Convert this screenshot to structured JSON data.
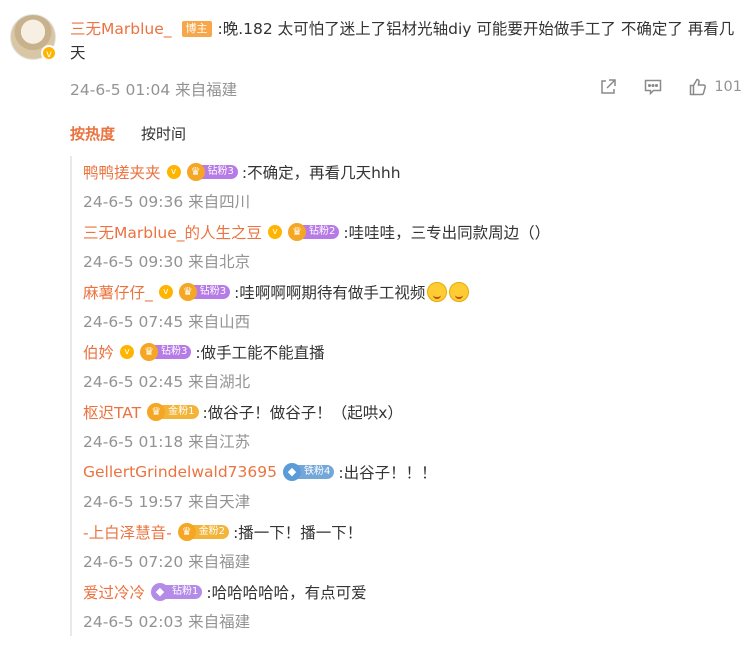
{
  "post": {
    "author": "三无Marblue_",
    "author_badge": "博主",
    "text": ":晚.182 太可怕了迷上了铝材光轴diy 可能要开始做手工了 不确定了 再看几天",
    "meta": "24-6-5 01:04 来自福建",
    "like_count": "101"
  },
  "sort": {
    "hot": "按热度",
    "time": "按时间"
  },
  "replies": [
    {
      "name": "鸭鸭搓夹夹",
      "fan": "钻粉3",
      "text": ":不确定，再看几天hhh",
      "meta": "24-6-5 09:36 来自四川"
    },
    {
      "name": "三无Marblue_的人生之豆",
      "fan": "钻粉2",
      "text": ":哇哇哇，三专出同款周边（）",
      "meta": "24-6-5 09:30 来自北京"
    },
    {
      "name": "麻薯仔仔_",
      "fan": "钻粉3",
      "text": ":哇啊啊啊期待有做手工视频",
      "meta": "24-6-5 07:45 来自山西"
    },
    {
      "name": "伯妗",
      "fan": "钻粉3",
      "text": ":做手工能不能直播",
      "meta": "24-6-5 02:45 来自湖北"
    },
    {
      "name": "枢迟TAT",
      "fan": "金粉1",
      "text": ":做谷子！做谷子！（起哄x）",
      "meta": "24-6-5 01:18 来自江苏"
    },
    {
      "name": "GellertGrindelwald73695",
      "fan": "铁粉4",
      "text": ":出谷子！！！",
      "meta": "24-6-5 19:57 来自天津"
    },
    {
      "name": "-上白泽慧音-",
      "fan": "金粉2",
      "text": ":播一下！播一下！",
      "meta": "24-6-5 07:20 来自福建"
    },
    {
      "name": "爱过冷冷",
      "fan": "钻粉1",
      "text": ":哈哈哈哈哈，有点可爱",
      "meta": "24-6-5 02:03 来自福建"
    }
  ],
  "icons": {
    "share": "share-icon",
    "comment": "comment-icon",
    "like": "thumb-up-icon",
    "verified": "verified-icon",
    "emoji": "emoji-grin-icon"
  },
  "colors": {
    "accent": "#eb7340",
    "meta": "#939393",
    "text": "#333333"
  }
}
